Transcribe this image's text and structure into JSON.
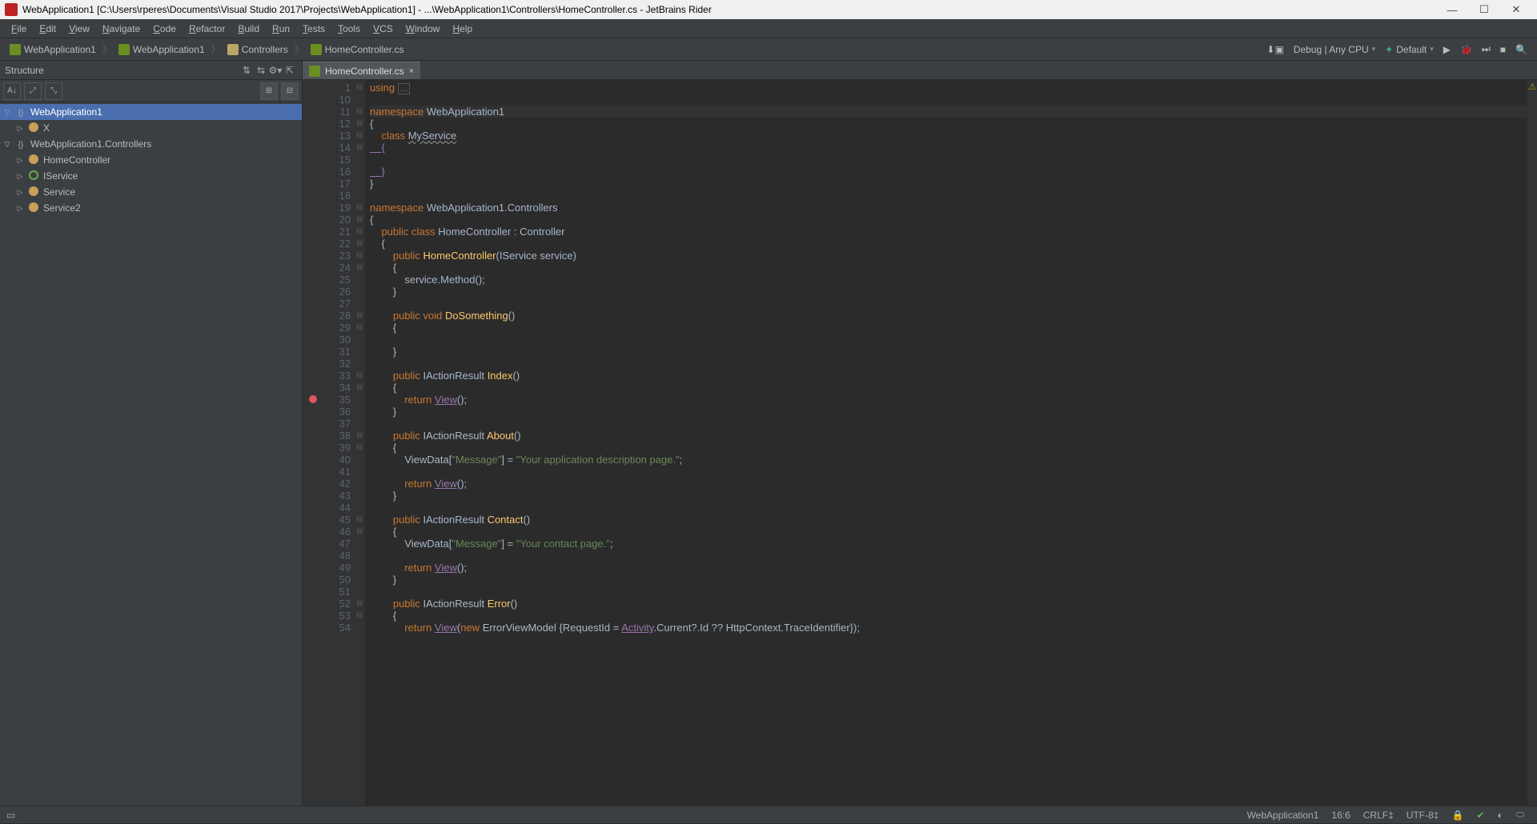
{
  "title": "WebApplication1 [C:\\Users\\rperes\\Documents\\Visual Studio 2017\\Projects\\WebApplication1] - ...\\WebApplication1\\Controllers\\HomeController.cs - JetBrains Rider",
  "menu": [
    "File",
    "Edit",
    "View",
    "Navigate",
    "Code",
    "Refactor",
    "Build",
    "Run",
    "Tests",
    "Tools",
    "VCS",
    "Window",
    "Help"
  ],
  "breadcrumbs": [
    {
      "label": "WebApplication1",
      "icon": "solution"
    },
    {
      "label": "WebApplication1",
      "icon": "project"
    },
    {
      "label": "Controllers",
      "icon": "folder"
    },
    {
      "label": "HomeController.cs",
      "icon": "csfile"
    }
  ],
  "run": {
    "config_label": "Debug | Any CPU",
    "target_label": "Default"
  },
  "structure": {
    "title": "Structure",
    "tree": [
      {
        "kind": "ns",
        "label": "WebApplication1",
        "expanded": true,
        "selected": true,
        "children": [
          {
            "kind": "class",
            "label": "X"
          }
        ]
      },
      {
        "kind": "ns",
        "label": "WebApplication1.Controllers",
        "expanded": true,
        "children": [
          {
            "kind": "class",
            "label": "HomeController"
          },
          {
            "kind": "interface",
            "label": "IService"
          },
          {
            "kind": "class",
            "label": "Service"
          },
          {
            "kind": "class",
            "label": "Service2"
          }
        ]
      }
    ]
  },
  "tab": {
    "label": "HomeController.cs"
  },
  "code": {
    "start_line": 1,
    "breakpoint_lines": [
      35
    ],
    "lines": [
      {
        "n": 1,
        "seg": [
          {
            "t": "using ",
            "c": "kw"
          },
          {
            "t": "...",
            "c": "fold-box"
          }
        ]
      },
      {
        "n": 10,
        "seg": []
      },
      {
        "n": 11,
        "seg": [
          {
            "t": "namespace ",
            "c": "kw"
          },
          {
            "t": "WebApplication1",
            "c": "type"
          }
        ],
        "hl": true
      },
      {
        "n": 12,
        "seg": [
          {
            "t": "{",
            "c": ""
          }
        ]
      },
      {
        "n": 13,
        "seg": [
          {
            "t": "    class ",
            "c": "kw"
          },
          {
            "t": "MyService",
            "c": "warn"
          }
        ]
      },
      {
        "n": 14,
        "seg": [
          {
            "t": "    {",
            "c": "link"
          }
        ]
      },
      {
        "n": 15,
        "seg": []
      },
      {
        "n": 16,
        "seg": [
          {
            "t": "    }",
            "c": "link"
          }
        ]
      },
      {
        "n": 17,
        "seg": [
          {
            "t": "}",
            "c": ""
          }
        ]
      },
      {
        "n": 18,
        "seg": []
      },
      {
        "n": 19,
        "seg": [
          {
            "t": "namespace ",
            "c": "kw"
          },
          {
            "t": "WebApplication1.Controllers",
            "c": "type"
          }
        ]
      },
      {
        "n": 20,
        "seg": [
          {
            "t": "{",
            "c": ""
          }
        ]
      },
      {
        "n": 21,
        "seg": [
          {
            "t": "    public class ",
            "c": "kw"
          },
          {
            "t": "HomeController",
            "c": "cls"
          },
          {
            "t": " : ",
            "c": ""
          },
          {
            "t": "Controller",
            "c": "base"
          }
        ]
      },
      {
        "n": 22,
        "seg": [
          {
            "t": "    {",
            "c": ""
          }
        ]
      },
      {
        "n": 23,
        "seg": [
          {
            "t": "        public ",
            "c": "kw"
          },
          {
            "t": "HomeController",
            "c": "fn"
          },
          {
            "t": "(IService service)",
            "c": ""
          }
        ]
      },
      {
        "n": 24,
        "seg": [
          {
            "t": "        {",
            "c": ""
          }
        ]
      },
      {
        "n": 25,
        "seg": [
          {
            "t": "            service.Method();",
            "c": ""
          }
        ]
      },
      {
        "n": 26,
        "seg": [
          {
            "t": "        }",
            "c": ""
          }
        ]
      },
      {
        "n": 27,
        "seg": []
      },
      {
        "n": 28,
        "seg": [
          {
            "t": "        public void ",
            "c": "kw"
          },
          {
            "t": "DoSomething",
            "c": "fn"
          },
          {
            "t": "()",
            "c": ""
          }
        ]
      },
      {
        "n": 29,
        "seg": [
          {
            "t": "        {",
            "c": ""
          }
        ]
      },
      {
        "n": 30,
        "seg": []
      },
      {
        "n": 31,
        "seg": [
          {
            "t": "        }",
            "c": ""
          }
        ]
      },
      {
        "n": 32,
        "seg": []
      },
      {
        "n": 33,
        "seg": [
          {
            "t": "        public ",
            "c": "kw"
          },
          {
            "t": "IActionResult ",
            "c": "type"
          },
          {
            "t": "Index",
            "c": "fn"
          },
          {
            "t": "()",
            "c": ""
          }
        ]
      },
      {
        "n": 34,
        "seg": [
          {
            "t": "        {",
            "c": ""
          }
        ]
      },
      {
        "n": 35,
        "seg": [
          {
            "t": "            return ",
            "c": "kw"
          },
          {
            "t": "View",
            "c": "link"
          },
          {
            "t": "();",
            "c": ""
          }
        ]
      },
      {
        "n": 36,
        "seg": [
          {
            "t": "        }",
            "c": ""
          }
        ]
      },
      {
        "n": 37,
        "seg": []
      },
      {
        "n": 38,
        "seg": [
          {
            "t": "        public ",
            "c": "kw"
          },
          {
            "t": "IActionResult ",
            "c": "type"
          },
          {
            "t": "About",
            "c": "fn"
          },
          {
            "t": "()",
            "c": ""
          }
        ]
      },
      {
        "n": 39,
        "seg": [
          {
            "t": "        {",
            "c": ""
          }
        ]
      },
      {
        "n": 40,
        "seg": [
          {
            "t": "            ViewData[",
            "c": ""
          },
          {
            "t": "\"Message\"",
            "c": "str"
          },
          {
            "t": "] = ",
            "c": ""
          },
          {
            "t": "\"Your application description page.\"",
            "c": "str"
          },
          {
            "t": ";",
            "c": ""
          }
        ]
      },
      {
        "n": 41,
        "seg": []
      },
      {
        "n": 42,
        "seg": [
          {
            "t": "            return ",
            "c": "kw"
          },
          {
            "t": "View",
            "c": "link"
          },
          {
            "t": "();",
            "c": ""
          }
        ]
      },
      {
        "n": 43,
        "seg": [
          {
            "t": "        }",
            "c": ""
          }
        ]
      },
      {
        "n": 44,
        "seg": []
      },
      {
        "n": 45,
        "seg": [
          {
            "t": "        public ",
            "c": "kw"
          },
          {
            "t": "IActionResult ",
            "c": "type"
          },
          {
            "t": "Contact",
            "c": "fn"
          },
          {
            "t": "()",
            "c": ""
          }
        ]
      },
      {
        "n": 46,
        "seg": [
          {
            "t": "        {",
            "c": ""
          }
        ]
      },
      {
        "n": 47,
        "seg": [
          {
            "t": "            ViewData[",
            "c": ""
          },
          {
            "t": "\"Message\"",
            "c": "str"
          },
          {
            "t": "] = ",
            "c": ""
          },
          {
            "t": "\"Your contact page.\"",
            "c": "str"
          },
          {
            "t": ";",
            "c": ""
          }
        ]
      },
      {
        "n": 48,
        "seg": []
      },
      {
        "n": 49,
        "seg": [
          {
            "t": "            return ",
            "c": "kw"
          },
          {
            "t": "View",
            "c": "link"
          },
          {
            "t": "();",
            "c": ""
          }
        ]
      },
      {
        "n": 50,
        "seg": [
          {
            "t": "        }",
            "c": ""
          }
        ]
      },
      {
        "n": 51,
        "seg": []
      },
      {
        "n": 52,
        "seg": [
          {
            "t": "        public ",
            "c": "kw"
          },
          {
            "t": "IActionResult ",
            "c": "type"
          },
          {
            "t": "Error",
            "c": "fn"
          },
          {
            "t": "()",
            "c": ""
          }
        ]
      },
      {
        "n": 53,
        "seg": [
          {
            "t": "        {",
            "c": ""
          }
        ]
      },
      {
        "n": 54,
        "seg": [
          {
            "t": "            return ",
            "c": "kw"
          },
          {
            "t": "View",
            "c": "link"
          },
          {
            "t": "(",
            "c": ""
          },
          {
            "t": "new ",
            "c": "kw"
          },
          {
            "t": "ErrorViewModel ",
            "c": "type"
          },
          {
            "t": "{RequestId = ",
            "c": ""
          },
          {
            "t": "Activity",
            "c": "link"
          },
          {
            "t": ".Current?.Id ?? HttpContext.TraceIdentifier});",
            "c": ""
          }
        ]
      }
    ]
  },
  "status": {
    "context": "WebApplication1",
    "pos": "16:6",
    "eol": "CRLF",
    "enc": "UTF-8"
  }
}
